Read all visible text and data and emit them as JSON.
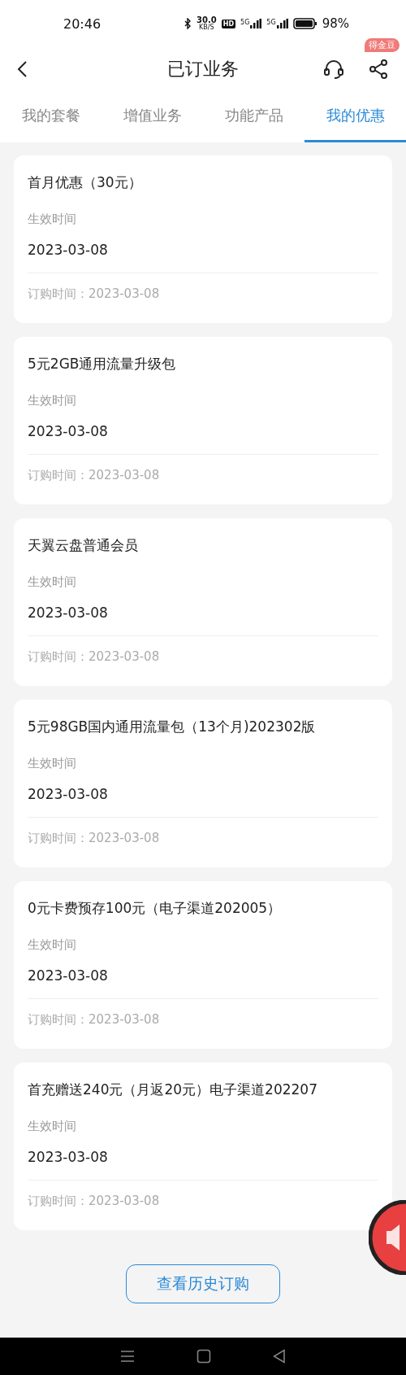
{
  "status_bar": {
    "time": "20:46",
    "net_speed": "30.0",
    "net_unit": "KB/S",
    "hd": "HD",
    "sim_1": "5G",
    "sim_2": "5G",
    "battery": "98%"
  },
  "header": {
    "title": "已订业务",
    "badge": "得金豆"
  },
  "tabs": [
    {
      "label": "我的套餐",
      "selected": false
    },
    {
      "label": "增值业务",
      "selected": false
    },
    {
      "label": "功能产品",
      "selected": false
    },
    {
      "label": "我的优惠",
      "selected": true
    }
  ],
  "offers": [
    {
      "name": "首月优惠（30元）",
      "effective_label": "生效时间",
      "effective_date": "2023-03-08",
      "order_time": "订购时间：2023-03-08"
    },
    {
      "name": "5元2GB通用流量升级包",
      "effective_label": "生效时间",
      "effective_date": "2023-03-08",
      "order_time": "订购时间：2023-03-08"
    },
    {
      "name": "天翼云盘普通会员",
      "effective_label": "生效时间",
      "effective_date": "2023-03-08",
      "order_time": "订购时间：2023-03-08"
    },
    {
      "name": "5元98GB国内通用流量包（13个月)202302版",
      "effective_label": "生效时间",
      "effective_date": "2023-03-08",
      "order_time": "订购时间：2023-03-08"
    },
    {
      "name": "0元卡费预存100元（电子渠道202005）",
      "effective_label": "生效时间",
      "effective_date": "2023-03-08",
      "order_time": "订购时间：2023-03-08"
    },
    {
      "name": "首充赠送240元（月返20元）电子渠道202207",
      "effective_label": "生效时间",
      "effective_date": "2023-03-08",
      "order_time": "订购时间：2023-03-08"
    }
  ],
  "history_button": "查看历史订购"
}
